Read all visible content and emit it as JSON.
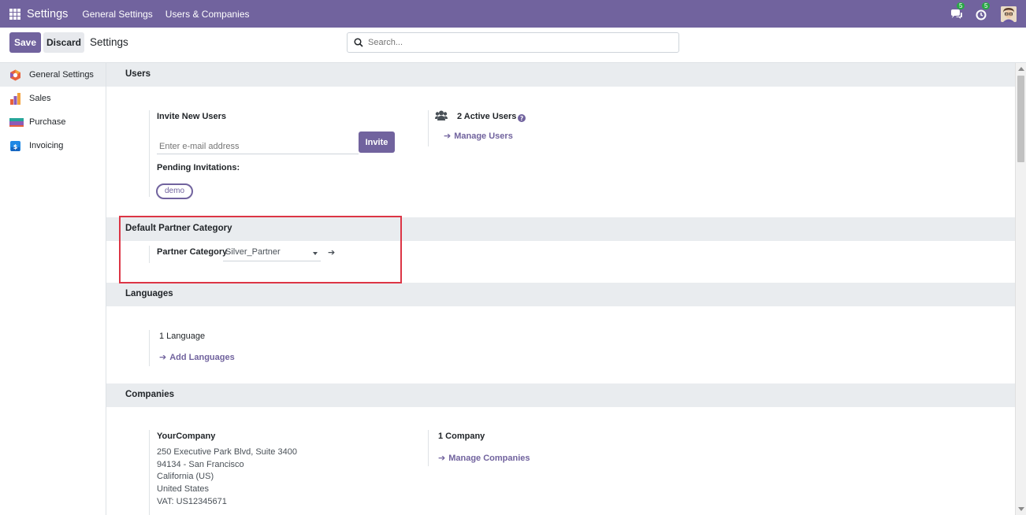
{
  "topbar": {
    "app_name": "Settings",
    "menu": [
      "General Settings",
      "Users & Companies"
    ],
    "messages_count": "5",
    "activities_count": "5"
  },
  "control_panel": {
    "save_label": "Save",
    "discard_label": "Discard",
    "title": "Settings",
    "search_placeholder": "Search..."
  },
  "sidebar": {
    "items": [
      {
        "label": "General Settings",
        "active": true
      },
      {
        "label": "Sales"
      },
      {
        "label": "Purchase"
      },
      {
        "label": "Invoicing"
      }
    ]
  },
  "users_section": {
    "title": "Users",
    "invite_label": "Invite New Users",
    "email_placeholder": "Enter e-mail address",
    "invite_button": "Invite",
    "pending_label": "Pending Invitations:",
    "pending": [
      "demo"
    ],
    "active_users": "2 Active Users",
    "manage_users": "Manage Users"
  },
  "partner_section": {
    "title": "Default Partner Category",
    "field_label": "Partner Category",
    "field_value": "Silver_Partner"
  },
  "languages_section": {
    "title": "Languages",
    "count": "1 Language",
    "add_link": "Add Languages"
  },
  "companies_section": {
    "title": "Companies",
    "company_name": "YourCompany",
    "address": [
      "250 Executive Park Blvd, Suite 3400",
      "94134 - San Francisco",
      "California (US)",
      "United States",
      "VAT:  US12345671"
    ],
    "count": "1 Company",
    "manage_link": "Manage Companies"
  },
  "colors": {
    "brand": "#71639e",
    "highlight": "#dc3545",
    "badge": "#28a745"
  }
}
